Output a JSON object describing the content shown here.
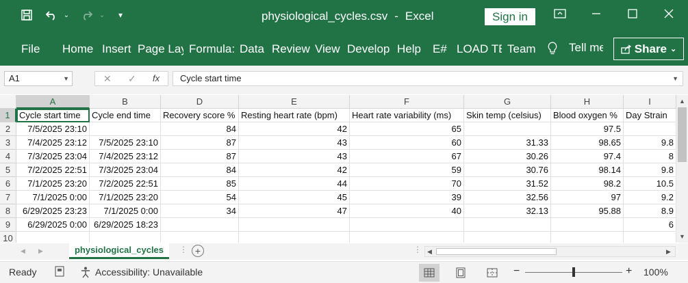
{
  "titlebar": {
    "filename": "physiological_cycles.csv",
    "separator": "-",
    "app": "Excel",
    "sign_in": "Sign in"
  },
  "ribbon": {
    "tabs": [
      "File",
      "Home",
      "Insert",
      "Page Lay",
      "Formula:",
      "Data",
      "Review",
      "View",
      "Develop",
      "Help",
      "E#",
      "LOAD TE",
      "Team"
    ],
    "tell_me": "Tell me",
    "share": "Share"
  },
  "formula_bar": {
    "name_box": "A1",
    "content": "Cycle start time"
  },
  "columns": [
    "A",
    "B",
    "D",
    "E",
    "F",
    "G",
    "H",
    "I"
  ],
  "rows": [
    "1",
    "2",
    "3",
    "4",
    "5",
    "6",
    "7",
    "8",
    "9",
    "10"
  ],
  "cells": [
    [
      "Cycle start time",
      "Cycle end time",
      "Recovery score %",
      "Resting heart rate (bpm)",
      "Heart rate variability (ms)",
      "Skin temp (celsius)",
      "Blood oxygen %",
      "Day Strain"
    ],
    [
      "7/5/2025 23:10",
      "",
      "84",
      "42",
      "65",
      "",
      "97.5",
      ""
    ],
    [
      "7/4/2025 23:12",
      "7/5/2025 23:10",
      "87",
      "43",
      "60",
      "31.33",
      "98.65",
      "9.8"
    ],
    [
      "7/3/2025 23:04",
      "7/4/2025 23:12",
      "87",
      "43",
      "67",
      "30.26",
      "97.4",
      "8"
    ],
    [
      "7/2/2025 22:51",
      "7/3/2025 23:04",
      "84",
      "42",
      "59",
      "30.76",
      "98.14",
      "9.8"
    ],
    [
      "7/1/2025 23:20",
      "7/2/2025 22:51",
      "85",
      "44",
      "70",
      "31.52",
      "98.2",
      "10.5"
    ],
    [
      "7/1/2025 0:00",
      "7/1/2025 23:20",
      "54",
      "45",
      "39",
      "32.56",
      "97",
      "9.2"
    ],
    [
      "6/29/2025 23:23",
      "7/1/2025 0:00",
      "34",
      "47",
      "40",
      "32.13",
      "95.88",
      "8.9"
    ],
    [
      "6/29/2025 0:00",
      "6/29/2025 18:23",
      "",
      "",
      "",
      "",
      "",
      "6"
    ],
    [
      "",
      "",
      "",
      "",
      "",
      "",
      "",
      ""
    ]
  ],
  "sheet": {
    "tab": "physiological_cycles"
  },
  "status": {
    "ready": "Ready",
    "accessibility": "Accessibility: Unavailable",
    "zoom": "100%",
    "zoom_minus": "−",
    "zoom_plus": "+"
  }
}
